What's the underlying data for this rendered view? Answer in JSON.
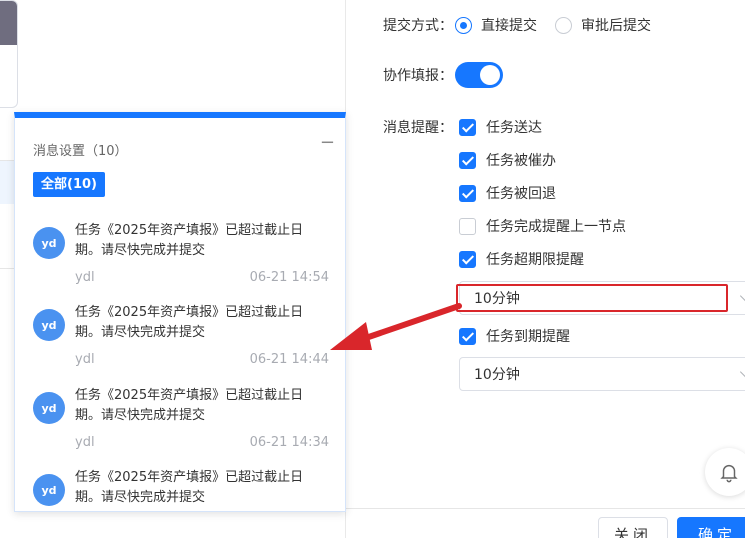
{
  "form": {
    "submit_mode_label": "提交方式：",
    "submit_options": [
      {
        "label": "直接提交",
        "selected": true
      },
      {
        "label": "审批后提交",
        "selected": false
      }
    ],
    "collab_label": "协作填报：",
    "collab_enabled": true,
    "reminder_label": "消息提醒：",
    "reminders": [
      {
        "label": "任务送达",
        "checked": true
      },
      {
        "label": "任务被催办",
        "checked": true
      },
      {
        "label": "任务被回退",
        "checked": true
      },
      {
        "label": "任务完成提醒上一节点",
        "checked": false
      },
      {
        "label": "任务超期限提醒",
        "checked": true
      }
    ],
    "overdue_select_value": "10分钟",
    "due_reminder": {
      "label": "任务到期提醒",
      "checked": true
    },
    "due_select_value": "10分钟",
    "close_label": "关闭",
    "ok_label": "确定"
  },
  "messages": {
    "title": "消息设置（10）",
    "minimize": "−",
    "tab_all": "全部(10)",
    "items": [
      {
        "avatar": "yd",
        "text": "任务《2025年资产填报》已超过截止日期。请尽快完成并提交",
        "user": "ydl",
        "time": "06-21 14:54"
      },
      {
        "avatar": "yd",
        "text": "任务《2025年资产填报》已超过截止日期。请尽快完成并提交",
        "user": "ydl",
        "time": "06-21 14:44"
      },
      {
        "avatar": "yd",
        "text": "任务《2025年资产填报》已超过截止日期。请尽快完成并提交",
        "user": "ydl",
        "time": "06-21 14:34"
      },
      {
        "avatar": "yd",
        "text": "任务《2025年资产填报》已超过截止日期。请尽快完成并提交"
      }
    ]
  },
  "colors": {
    "accent": "#1677ff",
    "highlight": "#d9262b"
  },
  "icons": {
    "bell": "bell-icon",
    "arrow": "red-arrow-icon"
  }
}
